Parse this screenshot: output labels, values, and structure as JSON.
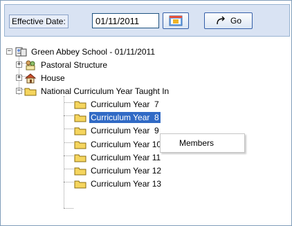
{
  "toolbar": {
    "effective_date_label": "Effective Date:",
    "effective_date_value": "01/11/2011",
    "go_label": "Go"
  },
  "tree": {
    "root": {
      "label": "Green Abbey School - 01/11/2011",
      "expanded": true
    },
    "children": [
      {
        "label": "Pastoral Structure",
        "expander": "+",
        "icon": "people-structure-icon"
      },
      {
        "label": "House",
        "expander": "+",
        "icon": "house-icon"
      },
      {
        "label": "National Curriculum Year Taught In",
        "expander": "−",
        "icon": "folder-icon"
      }
    ],
    "curriculum_years": [
      {
        "label": "Curriculum Year  7",
        "selected": false
      },
      {
        "label": "Curriculum Year  8",
        "selected": true
      },
      {
        "label": "Curriculum Year  9",
        "selected": false
      },
      {
        "label": "Curriculum Year 10",
        "selected": false
      },
      {
        "label": "Curriculum Year 11",
        "selected": false
      },
      {
        "label": "Curriculum Year 12",
        "selected": false
      },
      {
        "label": "Curriculum Year 13",
        "selected": false
      }
    ]
  },
  "context_menu": {
    "items": [
      {
        "label": "Members"
      }
    ]
  },
  "colors": {
    "toolbar_bg": "#d9e3f3",
    "selection": "#316ac5",
    "folder": "#f5d55e"
  }
}
